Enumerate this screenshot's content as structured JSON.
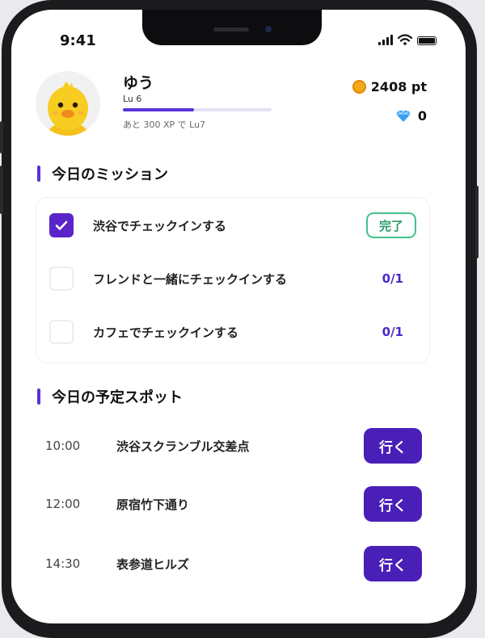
{
  "status_bar": {
    "time": "9:41"
  },
  "profile": {
    "name": "ゆう",
    "level": "Lu 6",
    "xp_progress": 0.48,
    "xp_note": "あと 300 XP で Lu7"
  },
  "wallet": {
    "points": "2408 pt",
    "gems": "0"
  },
  "missions": {
    "title": "今日のミッション",
    "items": [
      {
        "label": "渋谷でチェックインする",
        "status": "完了",
        "checked": true
      },
      {
        "label": "フレンドと一緒にチェックインする",
        "status": "0/1",
        "checked": false
      },
      {
        "label": "カフェでチェックインする",
        "status": "0/1",
        "checked": false
      }
    ]
  },
  "spots": {
    "title": "今日の予定スポット",
    "go_label": "行く",
    "items": [
      {
        "time": "10:00",
        "name": "渋谷スクランブル交差点"
      },
      {
        "time": "12:00",
        "name": "原宿竹下通り"
      },
      {
        "time": "14:30",
        "name": "表参道ヒルズ"
      }
    ]
  },
  "colors": {
    "accent": "#5b34d6",
    "button": "#4a1fb8",
    "done": "#43c28a",
    "coin": "#f2a91a",
    "gem": "#3aa0f0"
  }
}
